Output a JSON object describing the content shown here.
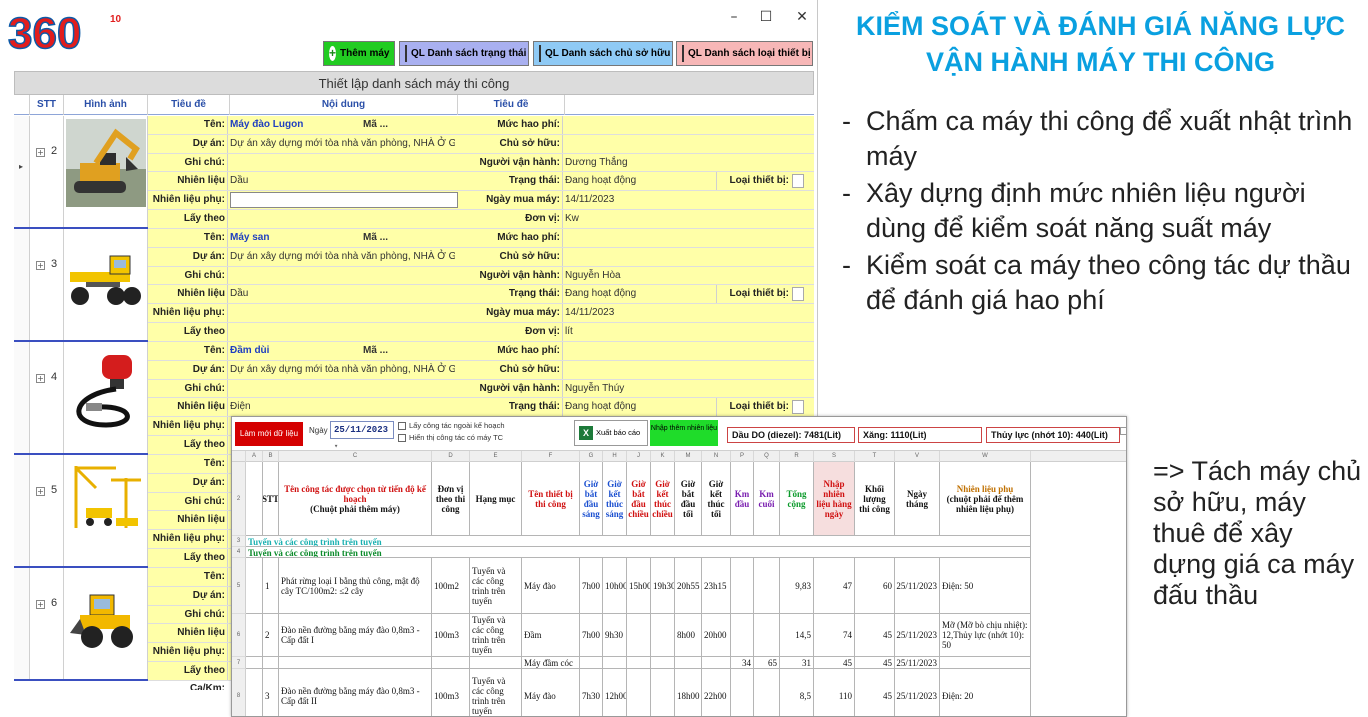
{
  "window": {
    "logo_text": "360",
    "logo_super": "10",
    "controls": {
      "minimize": "–",
      "maximize": "☐",
      "close": "✕"
    },
    "toolbar": {
      "add_label": "Thêm máy",
      "status_label": "QL Danh sách trạng thái",
      "owner_label": "QL Danh sách chủ sở hữu",
      "type_label": "QL Danh sách loại thiết bị"
    },
    "grid_title": "Thiết lập danh sách máy thi công",
    "columns": [
      "STT",
      "Hình ảnh",
      "Tiêu đề",
      "Nội dung",
      "Tiêu đề"
    ],
    "labels": {
      "ten": "Tên:",
      "du_an": "Dự án:",
      "ghi_chu": "Ghi chú:",
      "nl_chinh": "Nhiên liệu chính:",
      "nl_phu": "Nhiên liệu phụ:",
      "lay_theo": "Lấy theo Ca/Km:",
      "ma": "Mã ...",
      "muc_hao_phi": "Mức hao phí:",
      "chu_so_huu": "Chủ sở hữu:",
      "nguoi_van_hanh": "Người vận hành:",
      "trang_thai": "Trạng thái:",
      "ngay_mua": "Ngày mua máy:",
      "don_vi": "Đơn vị:",
      "loai_tb": "Loại thiết bị:"
    },
    "machines": [
      {
        "stt": "2",
        "image": "excavator-icon",
        "name": "Máy đào Lugon",
        "project": "Dự án xây dựng mới tòa nhà văn phòng, NHÀ Ở GIA...",
        "fuel": "Dầu",
        "operator": "Dương Thắng",
        "status": "Đang hoạt động",
        "date": "14/11/2023",
        "unit": "Kw"
      },
      {
        "stt": "3",
        "image": "grader-icon",
        "name": "Máy san",
        "project": "Dự án xây dựng mới tòa nhà văn phòng, NHÀ Ở GIA...",
        "fuel": "Dầu",
        "operator": "Nguyễn Hòa",
        "status": "Đang hoạt động",
        "date": "14/11/2023",
        "unit": "lít"
      },
      {
        "stt": "4",
        "image": "vibrator-icon",
        "name": "Đầm dùi",
        "project": "Dự án xây dựng mới tòa nhà văn phòng, NHÀ Ở GIA...",
        "fuel": "Điện",
        "operator": "Nguyễn Thúy",
        "status": "Đang hoạt động",
        "date": "",
        "unit": ""
      },
      {
        "stt": "5",
        "image": "construction-site-icon",
        "name": "",
        "project": "",
        "fuel": "",
        "operator": "",
        "status": "",
        "date": "",
        "unit": ""
      },
      {
        "stt": "6",
        "image": "loader-icon",
        "name": "",
        "project": "",
        "fuel": "",
        "operator": "",
        "status": "",
        "date": "",
        "unit": ""
      }
    ]
  },
  "heading": "KIỂM SOÁT VÀ ĐÁNH GIÁ NĂNG LỰC VẬN HÀNH MÁY THI CÔNG",
  "bullets": [
    "Chấm ca máy thi công để xuất nhật trình máy",
    "Xây dựng định mức nhiên liệu người dùng để kiểm soát năng suất máy",
    "Kiểm soát ca máy theo công tác dự thầu để đánh giá hao phí"
  ],
  "conclusion": "=> Tách máy chủ sở hữu, máy thuê để xây dựng giá ca máy đấu thầu",
  "sheet": {
    "new_button": "Làm mới dữ liệu",
    "date_label": "Ngày",
    "date_value": "25/11/2023",
    "check1": "Lấy công tác ngoài kế hoạch",
    "check2": "Hiển thị công tác có máy TC",
    "report_button": "Xuất báo cáo",
    "fuel_button": "Nhập thêm nhiên liệu",
    "tot_diesel": "Dầu DO (diezel): 7481(Lit)",
    "tot_xang": "Xăng: 1110(Lit)",
    "tot_thuyluc": "Thủy lực (nhớt 10): 440(Lit)",
    "col_letters": [
      "A",
      "B",
      "C",
      "D",
      "E",
      "F",
      "G",
      "H",
      "J",
      "K",
      "M",
      "N",
      "P",
      "Q",
      "R",
      "S",
      "T",
      "V",
      "W"
    ],
    "headers": {
      "stt": "STT",
      "ten_cong_tac": "Tên công tác được chọn từ tiến độ kế hoạch",
      "ten_cong_tac_note": "(Chuột phải thêm máy)",
      "don_vi": "Đơn vị theo thi công",
      "hang_muc": "Hạng mục",
      "ten_tb": "Tên thiết bị thi công",
      "g1": "Giờ bắt đầu sáng",
      "g2": "Giờ kết thúc sáng",
      "g3": "Giờ bắt đầu chiều",
      "g4": "Giờ kết thúc chiều",
      "g5": "Giờ bắt đầu tối",
      "g6": "Giờ kết thúc tối",
      "km_dau": "Km đầu",
      "km_cuoi": "Km cuối",
      "tong": "Tổng cộng",
      "nhap_nl": "Nhập nhiên liệu hàng ngày",
      "khoi_luong": "Khối lượng thi công",
      "ngay_thang": "Ngày tháng",
      "nl_phu": "Nhiên liệu phụ",
      "nl_phu_note": "(chuột phải để thêm nhiên liệu phụ)"
    },
    "row_numbers": [
      "2",
      "3",
      "4",
      "5",
      "6",
      "7",
      "8"
    ],
    "section1": "Tuyến và các công trình trên tuyến",
    "section2": "Tuyến và các công trình trên tuyến",
    "rows": [
      {
        "stt": "1",
        "task": "Phát rừng loại I bằng thủ công, mật độ cây TC/100m2: ≤2 cây",
        "unit": "100m2",
        "cat": "Tuyến và các công trình trên tuyến",
        "eq": "Máy đào",
        "g1": "7h00",
        "g2": "10h00",
        "g3": "15h00",
        "g4": "19h30",
        "g5": "20h55",
        "g6": "23h15",
        "km1": "",
        "km2": "",
        "tong": "9,83",
        "nl": "47",
        "kl": "60",
        "date": "25/11/2023",
        "phu": "Điện: 50"
      },
      {
        "stt": "2",
        "task": "Đào nền đường bằng máy đào 0,8m3 - Cấp đất I",
        "unit": "100m3",
        "cat": "Tuyến và các công trình trên tuyến",
        "eq": "Đầm",
        "g1": "7h00",
        "g2": "9h30",
        "g3": "",
        "g4": "",
        "g5": "8h00",
        "g6": "20h00",
        "km1": "",
        "km2": "",
        "tong": "14,5",
        "nl": "74",
        "kl": "45",
        "date": "25/11/2023",
        "phu": "Mỡ (Mỡ bò chịu nhiệt): 12,Thủy lực (nhớt 10): 50"
      },
      {
        "stt": "",
        "task": "",
        "unit": "",
        "cat": "",
        "eq": "Máy đầm cóc",
        "g1": "",
        "g2": "",
        "g3": "",
        "g4": "",
        "g5": "",
        "g6": "",
        "km1": "34",
        "km2": "65",
        "tong": "31",
        "nl": "45",
        "kl": "45",
        "date": "25/11/2023",
        "phu": ""
      },
      {
        "stt": "3",
        "task": "Đào nền đường bằng máy đào 0,8m3 - Cấp đất II",
        "unit": "100m3",
        "cat": "Tuyến và các công trình trên tuyến",
        "eq": "Máy đào",
        "g1": "7h30",
        "g2": "12h00",
        "g3": "",
        "g4": "",
        "g5": "18h00",
        "g6": "22h00",
        "km1": "",
        "km2": "",
        "tong": "8,5",
        "nl": "110",
        "kl": "45",
        "date": "25/11/2023",
        "phu": "Điện: 20"
      }
    ]
  }
}
